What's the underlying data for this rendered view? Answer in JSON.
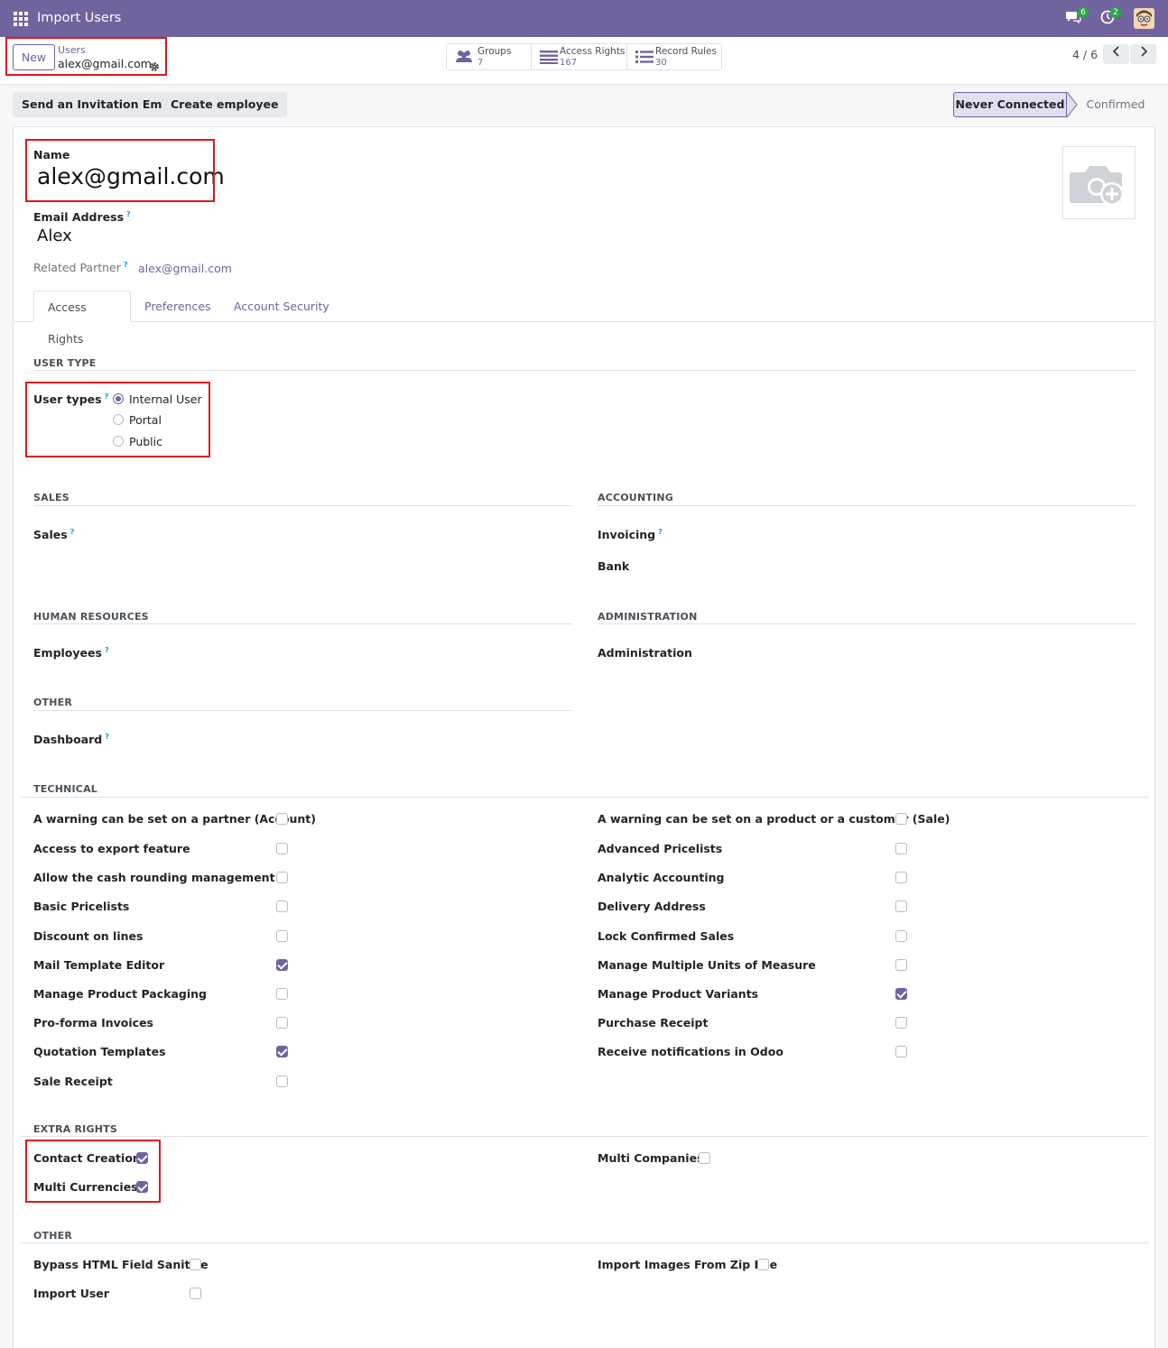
{
  "app": {
    "title": "Import Users"
  },
  "systray": {
    "messages_count": "6",
    "activities_count": "2"
  },
  "control_panel": {
    "new_label": "New",
    "breadcrumb_parent": "Users",
    "breadcrumb_current": "alex@gmail.com",
    "smart_buttons": [
      {
        "label": "Groups",
        "count": "7"
      },
      {
        "label": "Access Rights",
        "count": "167"
      },
      {
        "label": "Record Rules",
        "count": "30"
      }
    ],
    "pager": "4 / 6"
  },
  "actions": {
    "invite_label": "Send an Invitation Email",
    "employee_label": "Create employee",
    "status_current": "Never Connected",
    "status_next": "Confirmed"
  },
  "form": {
    "name_label": "Name",
    "name_value": "alex@gmail.com",
    "email_label": "Email Address",
    "email_value": "Alex",
    "partner_label": "Related Partner",
    "partner_value": "alex@gmail.com",
    "help_mark": "?"
  },
  "tabs": [
    "Access Rights",
    "Preferences",
    "Account Security"
  ],
  "user_type": {
    "section": "USER TYPE",
    "label": "User types",
    "options": [
      {
        "label": "Internal User",
        "selected": true
      },
      {
        "label": "Portal",
        "selected": false
      },
      {
        "label": "Public",
        "selected": false
      }
    ]
  },
  "apps": {
    "sales_title": "SALES",
    "sales_label": "Sales",
    "accounting_title": "ACCOUNTING",
    "invoicing_label": "Invoicing",
    "bank_label": "Bank",
    "hr_title": "HUMAN RESOURCES",
    "employees_label": "Employees",
    "admin_title": "ADMINISTRATION",
    "admin_label": "Administration",
    "other_title": "OTHER",
    "dashboard_label": "Dashboard"
  },
  "technical": {
    "title": "TECHNICAL",
    "left": [
      {
        "label": "A warning can be set on a partner (Account)",
        "checked": false
      },
      {
        "label": "Access to export feature",
        "checked": false
      },
      {
        "label": "Allow the cash rounding management",
        "checked": false
      },
      {
        "label": "Basic Pricelists",
        "checked": false
      },
      {
        "label": "Discount on lines",
        "checked": false
      },
      {
        "label": "Mail Template Editor",
        "checked": true
      },
      {
        "label": "Manage Product Packaging",
        "checked": false
      },
      {
        "label": "Pro-forma Invoices",
        "checked": false
      },
      {
        "label": "Quotation Templates",
        "checked": true
      },
      {
        "label": "Sale Receipt",
        "checked": false
      }
    ],
    "right": [
      {
        "label": "A warning can be set on a product or a customer (Sale)",
        "checked": false
      },
      {
        "label": "Advanced Pricelists",
        "checked": false
      },
      {
        "label": "Analytic Accounting",
        "checked": false
      },
      {
        "label": "Delivery Address",
        "checked": false
      },
      {
        "label": "Lock Confirmed Sales",
        "checked": false
      },
      {
        "label": "Manage Multiple Units of Measure",
        "checked": false
      },
      {
        "label": "Manage Product Variants",
        "checked": true
      },
      {
        "label": "Purchase Receipt",
        "checked": false
      },
      {
        "label": "Receive notifications in Odoo",
        "checked": false
      }
    ]
  },
  "extra_rights": {
    "title": "EXTRA RIGHTS",
    "left": [
      {
        "label": "Contact Creation",
        "checked": true
      },
      {
        "label": "Multi Currencies",
        "checked": true
      }
    ],
    "right": [
      {
        "label": "Multi Companies",
        "checked": false
      }
    ]
  },
  "other": {
    "title": "OTHER",
    "left": [
      {
        "label": "Bypass HTML Field Sanitize",
        "checked": false
      },
      {
        "label": "Import User",
        "checked": false
      }
    ],
    "right": [
      {
        "label": "Import Images From Zip File",
        "checked": false
      }
    ]
  }
}
